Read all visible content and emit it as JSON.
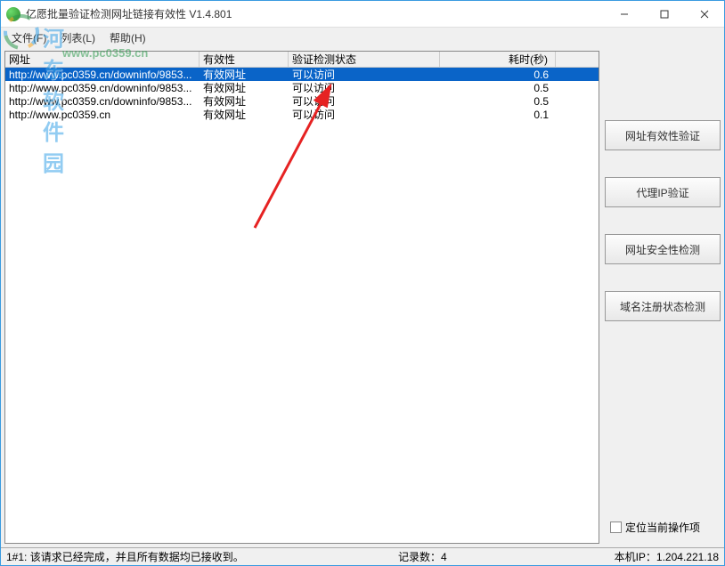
{
  "window": {
    "title": "亿愿批量验证检测网址链接有效性 V1.4.801"
  },
  "menu": {
    "file": "文件(F)",
    "list": "列表(L)",
    "help": "帮助(H)"
  },
  "columns": {
    "url": "网址",
    "valid": "有效性",
    "status": "验证检测状态",
    "time": "耗时(秒)"
  },
  "rows": [
    {
      "url": "http://www.pc0359.cn/downinfo/9853...",
      "valid": "有效网址",
      "status": "可以访问",
      "time": "0.6",
      "selected": true
    },
    {
      "url": "http://www.pc0359.cn/downinfo/9853...",
      "valid": "有效网址",
      "status": "可以访问",
      "time": "0.5",
      "selected": false
    },
    {
      "url": "http://www.pc0359.cn/downinfo/9853...",
      "valid": "有效网址",
      "status": "可以访问",
      "time": "0.5",
      "selected": false
    },
    {
      "url": "http://www.pc0359.cn",
      "valid": "有效网址",
      "status": "可以访问",
      "time": "0.1",
      "selected": false
    }
  ],
  "buttons": {
    "validate_url": "网址有效性验证",
    "validate_proxy": "代理IP验证",
    "security_check": "网址安全性检测",
    "domain_status": "域名注册状态检测"
  },
  "checkbox": {
    "locate_current": "定位当前操作项"
  },
  "status": {
    "left": "1#1: 该请求已经完成，并且所有数据均已接收到。",
    "record_label": "记录数：",
    "record_count": "4",
    "ip_label": "本机IP：",
    "ip_value": "1.204.221.18"
  },
  "watermark": {
    "line1": "河东软件园",
    "line2": "www.pc0359.cn"
  }
}
